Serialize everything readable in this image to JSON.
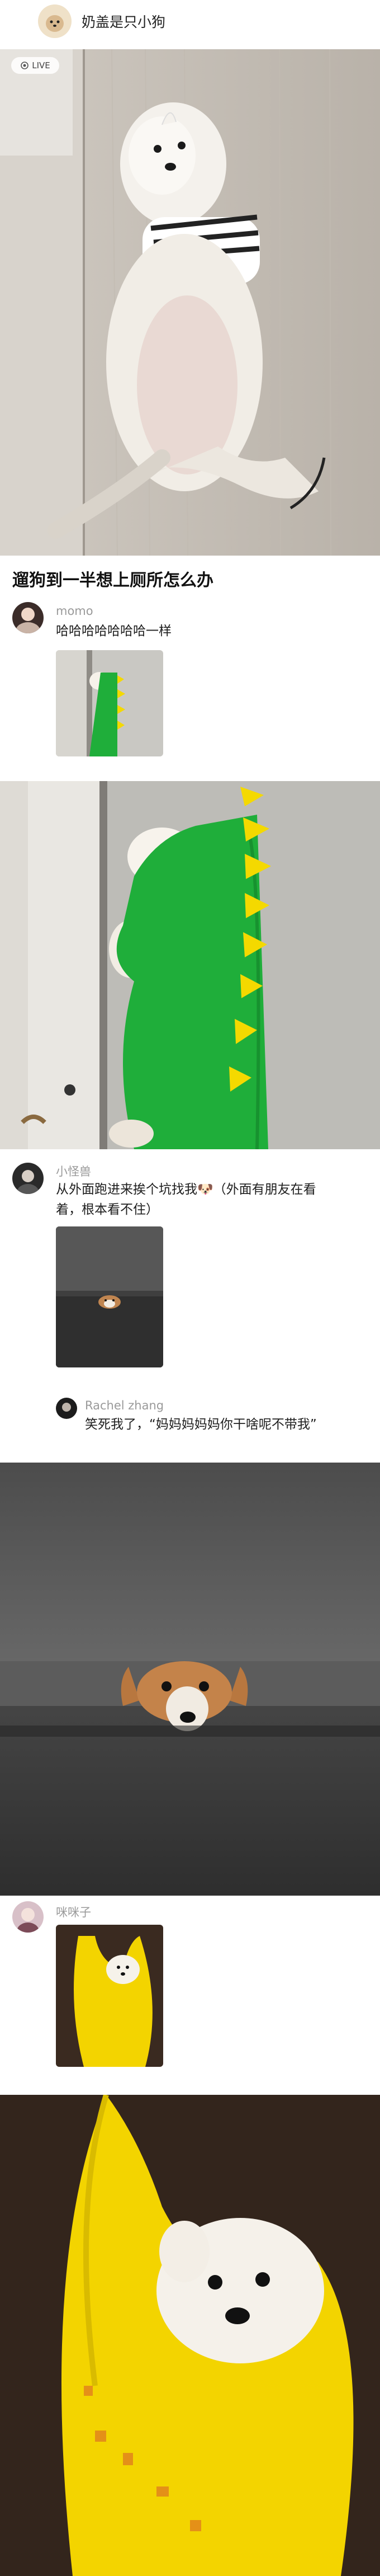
{
  "header": {
    "username": "奶盖是只小狗"
  },
  "post": {
    "live_label": "LIVE",
    "title": "遛狗到一半想上厕所怎么办"
  },
  "comments": [
    {
      "name": "momo",
      "text": "哈哈哈哈哈哈哈一样"
    },
    {
      "name": "小怪兽",
      "text_line1": "从外面跑进来挨个坑找我🐶（外面有朋友在看",
      "text_line2": "着，根本看不住）"
    },
    {
      "name": "Rachel zhang",
      "text": "笑死我了，“妈妈妈妈妈你干啥呢不带我”"
    },
    {
      "name": "咪咪子"
    }
  ],
  "colors": {
    "background": "#ffffff",
    "meta_text": "#9a9a9a",
    "body_text": "#1e1e1e",
    "dino_green": "#1fae3a",
    "bag_yellow": "#f3d400"
  }
}
